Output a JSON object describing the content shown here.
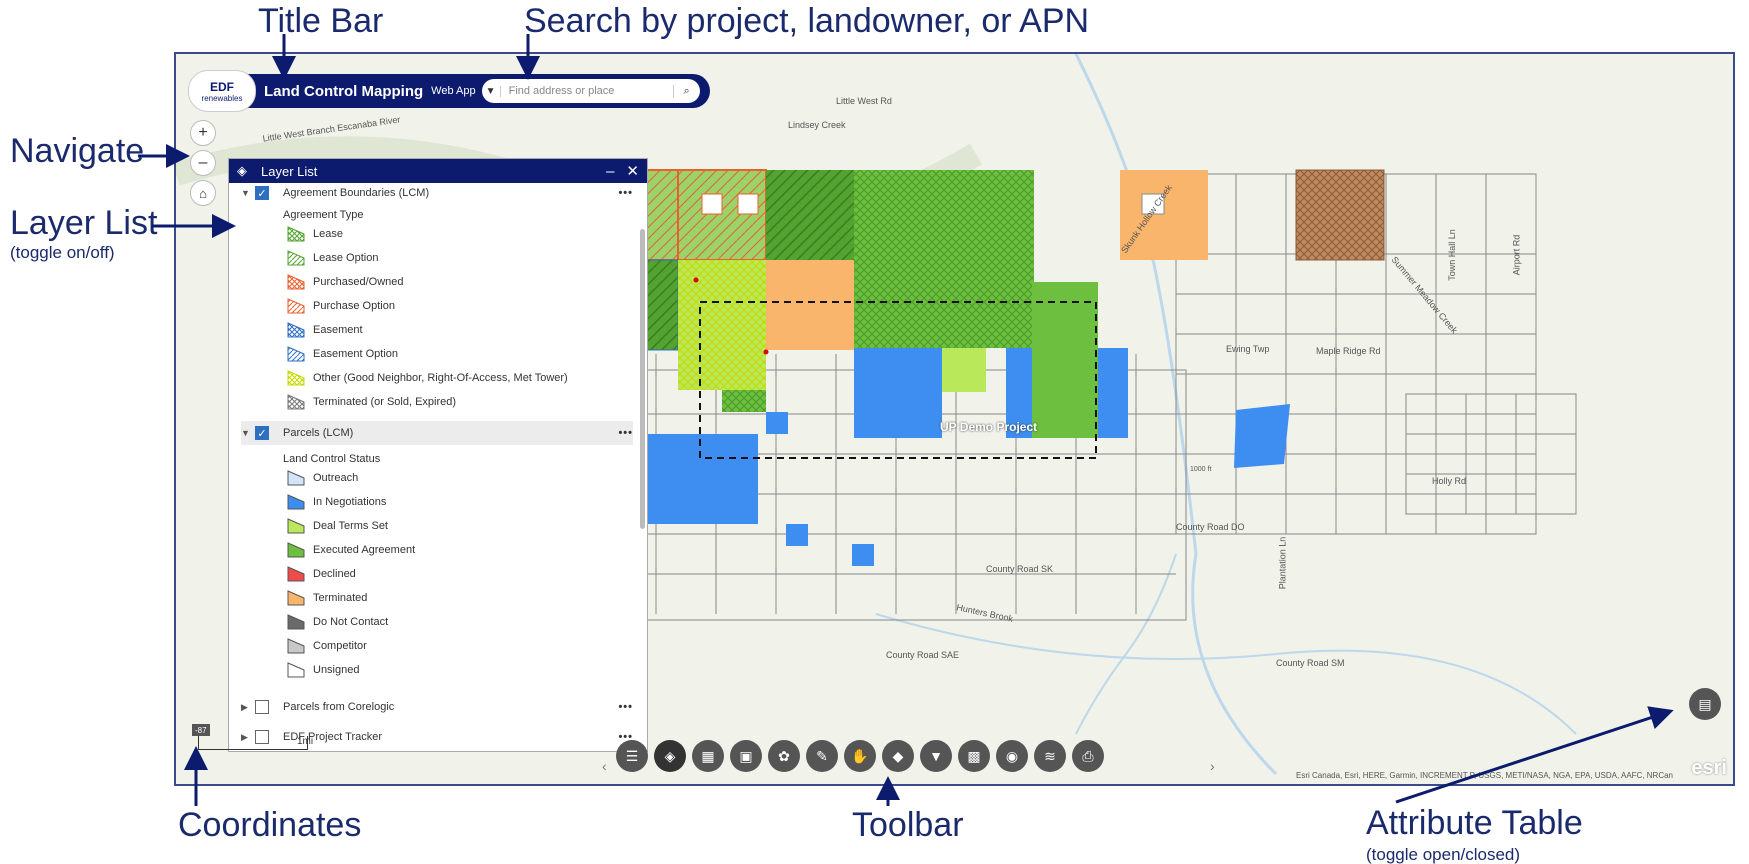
{
  "annotations": {
    "title_bar": "Title Bar",
    "search": "Search by project, landowner, or APN",
    "navigate": "Navigate",
    "layer_list": "Layer List",
    "layer_list_sub": "(toggle on/off)",
    "coordinates": "Coordinates",
    "toolbar": "Toolbar",
    "attribute_table": "Attribute Table",
    "attribute_table_sub": "(toggle open/closed)"
  },
  "header": {
    "logo_brand": "EDF",
    "logo_sub": "renewables",
    "title": "Land Control Mapping",
    "web_app": "Web App",
    "search_placeholder": "Find address or place"
  },
  "nav": {
    "zoom_in": "+",
    "zoom_out": "–",
    "home": "⌂"
  },
  "layer_list": {
    "title": "Layer List",
    "minimize": "–",
    "close": "✕",
    "layers": [
      {
        "name": "Agreement Boundaries (LCM)",
        "checked": true
      },
      {
        "name": "Parcels (LCM)",
        "checked": true
      },
      {
        "name": "Parcels from Corelogic",
        "checked": false
      },
      {
        "name": "EDF Project Tracker",
        "checked": false
      }
    ],
    "more": "•••",
    "agreement_group": "Agreement Type",
    "agreement_items": [
      {
        "label": "Lease",
        "color": "#52a32f",
        "pattern": "cross"
      },
      {
        "label": "Lease Option",
        "color": "#52a32f",
        "pattern": "hatch"
      },
      {
        "label": "Purchased/Owned",
        "color": "#e8602c",
        "pattern": "cross"
      },
      {
        "label": "Purchase Option",
        "color": "#e8602c",
        "pattern": "hatch"
      },
      {
        "label": "Easement",
        "color": "#2f6fc2",
        "pattern": "cross"
      },
      {
        "label": "Easement Option",
        "color": "#2f6fc2",
        "pattern": "hatch"
      },
      {
        "label": "Other (Good Neighbor, Right-Of-Access, Met Tower)",
        "color": "#c6d800",
        "pattern": "cross"
      },
      {
        "label": "Terminated (or Sold, Expired)",
        "color": "#777777",
        "pattern": "cross"
      }
    ],
    "status_group": "Land Control Status",
    "status_items": [
      {
        "label": "Outreach",
        "color": "#d3e3f8"
      },
      {
        "label": "In Negotiations",
        "color": "#3d8ef0"
      },
      {
        "label": "Deal Terms Set",
        "color": "#b9e85a"
      },
      {
        "label": "Executed Agreement",
        "color": "#6cbf3f"
      },
      {
        "label": "Declined",
        "color": "#f04b4b"
      },
      {
        "label": "Terminated",
        "color": "#f9b56b"
      },
      {
        "label": "Do Not Contact",
        "color": "#6a6a6a"
      },
      {
        "label": "Competitor",
        "color": "#c8c8c8"
      },
      {
        "label": "Unsigned",
        "color": "#ffffff"
      }
    ]
  },
  "map": {
    "project_label": "UP Demo Project",
    "labels": [
      {
        "text": "Little West Branch Escanaba River"
      },
      {
        "text": "Little West Rd"
      },
      {
        "text": "Lindsey Creek"
      },
      {
        "text": "Ewing Twp"
      },
      {
        "text": "Maple Ridge Rd"
      },
      {
        "text": "County Road DO"
      },
      {
        "text": "County Road SK"
      },
      {
        "text": "Hunters Brook"
      },
      {
        "text": "County Road SAE"
      },
      {
        "text": "County Road SM"
      },
      {
        "text": "Holly Rd"
      },
      {
        "text": "Summer Meadow Creek"
      },
      {
        "text": "Town Hall Ln"
      },
      {
        "text": "Airport Rd"
      },
      {
        "text": "Plantation Ln"
      },
      {
        "text": "1000 ft"
      },
      {
        "text": "Skunk Hollow Creek"
      }
    ],
    "coordinates": "-87",
    "scale": "1mi",
    "attribution": "Esri Canada, Esri, HERE, Garmin, INCREMENT P, USGS, METI/NASA, NGA, EPA, USDA, AAFC, NRCan",
    "esri": "esri",
    "prev": "‹",
    "next": "›"
  },
  "toolbar": {
    "icons": [
      "list-icon",
      "layers-icon",
      "basemap-icon",
      "bookmark-icon",
      "share-icon",
      "measure-icon",
      "draw-icon",
      "print-layer-icon",
      "filter-icon",
      "legend-icon",
      "screenshot-icon",
      "layer-stack-icon",
      "print-icon"
    ],
    "glyphs": [
      "☰",
      "◈",
      "▦",
      "▣",
      "✿",
      "✎",
      "✋",
      "◆",
      "▼",
      "▩",
      "◉",
      "≋",
      "⎙"
    ],
    "attribute_glyph": "▤"
  },
  "colors": {
    "navy": "#0d1b6e",
    "executed": "#6cbf3f",
    "negotiations": "#3d8ef0",
    "terminated": "#f9b56b",
    "purchased": "#e8602c"
  }
}
